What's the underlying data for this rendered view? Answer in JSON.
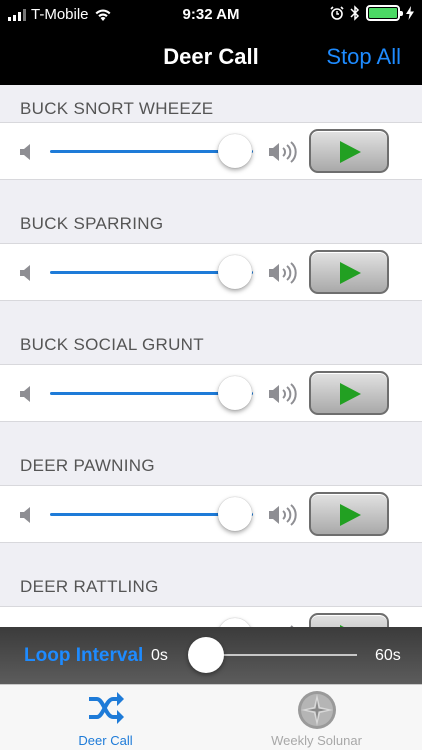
{
  "status_bar": {
    "carrier": "T-Mobile",
    "time": "9:32 AM"
  },
  "nav": {
    "title": "Deer Call",
    "stop_all": "Stop All"
  },
  "sounds": [
    {
      "name": "BUCK SNORT WHEEZE",
      "volume": 0.91
    },
    {
      "name": "BUCK SPARRING",
      "volume": 0.91
    },
    {
      "name": "BUCK SOCIAL GRUNT",
      "volume": 0.91
    },
    {
      "name": "DEER PAWNING",
      "volume": 0.91
    },
    {
      "name": "DEER RATTLING",
      "volume": 0.91
    }
  ],
  "loop": {
    "label": "Loop Interval",
    "min_label": "0s",
    "max_label": "60s",
    "value": 0.1
  },
  "tabs": [
    {
      "label": "Deer Call",
      "icon": "shuffle-icon",
      "active": true
    },
    {
      "label": "Weekly Solunar",
      "icon": "compass-icon",
      "active": false
    }
  ],
  "colors": {
    "accent": "#1e8bff",
    "play": "#22a022",
    "battery": "#4cd964"
  }
}
